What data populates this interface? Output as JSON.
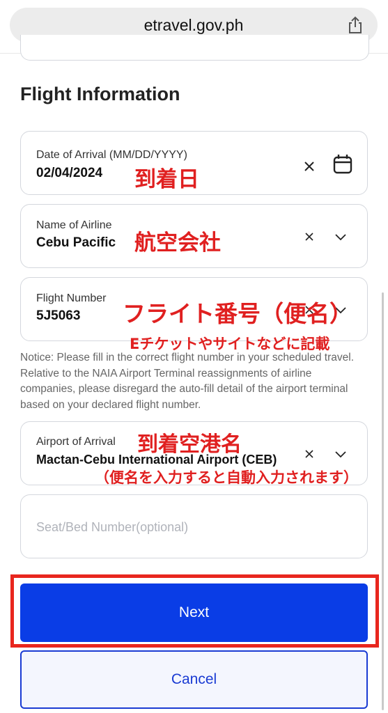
{
  "browser": {
    "url": "etravel.gov.ph"
  },
  "section": {
    "title": "Flight Information"
  },
  "fields": {
    "arrival_date": {
      "label": "Date of Arrival (MM/DD/YYYY)",
      "value": "02/04/2024"
    },
    "airline": {
      "label": "Name of Airline",
      "value": "Cebu Pacific"
    },
    "flight_number": {
      "label": "Flight Number",
      "value": "5J5063"
    },
    "airport": {
      "label": "Airport of Arrival",
      "value": "Mactan-Cebu International Airport (CEB)"
    },
    "seat": {
      "placeholder": "Seat/Bed Number(optional)"
    }
  },
  "notice": "Notice: Please fill in the correct flight number in your scheduled travel. Relative to the NAIA Airport Terminal reassignments of airline companies, please disregard the auto-fill detail of the airport terminal based on your declared flight number.",
  "annotations": {
    "arrival_date": "到着日",
    "airline": "航空会社",
    "flight_number": "フライト番号（便名）",
    "flight_number_sub": "Eチケットやサイトなどに記載",
    "airport": "到着空港名",
    "airport_sub": "（便名を入力すると自動入力されます）"
  },
  "buttons": {
    "next": "Next",
    "cancel": "Cancel"
  },
  "colors": {
    "primary": "#0a3de6",
    "annotation": "#e02020"
  },
  "icons": [
    "share-icon",
    "clear-icon",
    "calendar-icon",
    "chevron-down-icon"
  ]
}
